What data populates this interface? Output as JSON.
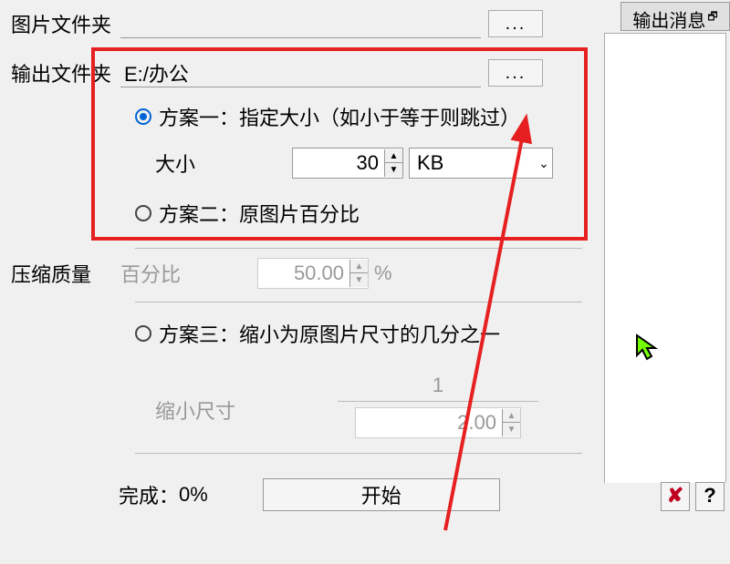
{
  "header": {
    "output_msg_label": "输出消息"
  },
  "folders": {
    "image_folder_label": "图片文件夹",
    "image_folder_value": "",
    "output_folder_label": "输出文件夹",
    "output_folder_value": "E:/办公",
    "browse_label": "..."
  },
  "options": {
    "opt1_label": "方案一：指定大小（如小于等于则跳过）",
    "opt1_selected": true,
    "size_label": "大小",
    "size_value": "30",
    "size_unit": "KB",
    "opt2_label": "方案二：原图片百分比",
    "opt2_selected": false,
    "quality_label": "压缩质量",
    "percent_label": "百分比",
    "percent_value": "50.00",
    "percent_unit": "%",
    "opt3_label": "方案三：缩小为原图片尺寸的几分之一",
    "opt3_selected": false,
    "shrink_label": "缩小尺寸",
    "fraction_numerator": "1",
    "fraction_denominator": "2.00"
  },
  "footer": {
    "progress_label": "完成：",
    "progress_value": "0%",
    "start_label": "开始"
  },
  "corner": {
    "close_glyph": "✘",
    "help_glyph": "?"
  }
}
